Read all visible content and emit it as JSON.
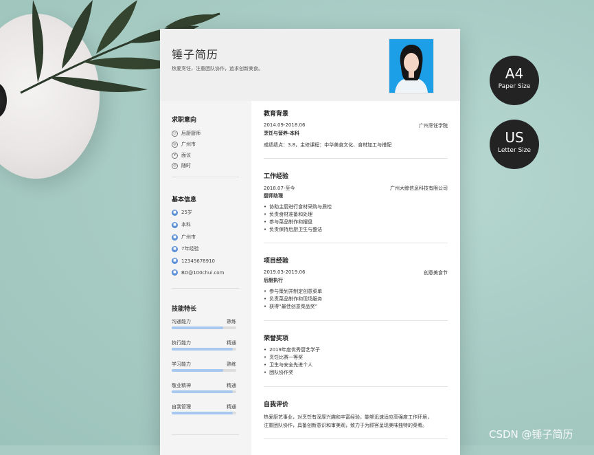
{
  "resume": {
    "name": "锤子简历",
    "motto": "热爱烹饪，注重团队协作，追求创新美食。"
  },
  "sidebar": {
    "intent_title": "求职意向",
    "intent": [
      {
        "icon": "chef-icon",
        "text": "后厨厨师"
      },
      {
        "icon": "location-icon",
        "text": "广州市"
      },
      {
        "icon": "salary-icon",
        "text": "面议"
      },
      {
        "icon": "clock-icon",
        "text": "随时"
      }
    ],
    "basic_title": "基本信息",
    "basic": [
      {
        "icon": "age-icon",
        "text": "25岁"
      },
      {
        "icon": "education-icon",
        "text": "本科"
      },
      {
        "icon": "home-icon",
        "text": "广州市"
      },
      {
        "icon": "experience-icon",
        "text": "7年经验"
      },
      {
        "icon": "phone-icon",
        "text": "12345678910"
      },
      {
        "icon": "email-icon",
        "text": "BD@100chui.com"
      }
    ],
    "skills_title": "技能特长",
    "skills": [
      {
        "name": "沟通能力",
        "level": "熟练",
        "progress": 0.8
      },
      {
        "name": "执行能力",
        "level": "精通",
        "progress": 0.95
      },
      {
        "name": "学习能力",
        "level": "熟练",
        "progress": 0.8
      },
      {
        "name": "敬业精神",
        "level": "精通",
        "progress": 0.95
      },
      {
        "name": "自我管理",
        "level": "精通",
        "progress": 0.95
      }
    ]
  },
  "education": {
    "title": "教育背景",
    "period": "2014.09-2018.06",
    "school": "广州烹饪学院",
    "major": "烹饪与营养-本科",
    "detail": "成绩绩点：3.8，主修课程：中华美食文化、食材加工与搭配"
  },
  "work": {
    "title": "工作经验",
    "period": "2018.07-至今",
    "company": "广州大鲸信息科技有限公司",
    "role": "厨师助理",
    "items": [
      "协助主厨进行食材采购与质检",
      "负责食材准备和处理",
      "参与菜品制作和摆盘",
      "负责保持后厨卫生与整洁"
    ]
  },
  "project": {
    "title": "项目经验",
    "period": "2019.03-2019.06",
    "name": "创意美食节",
    "role": "后厨执行",
    "items": [
      "参与策划并制定创意菜单",
      "负责菜品制作和现场服务",
      "获得“最佳创意菜品奖”"
    ]
  },
  "honors": {
    "title": "荣誉奖项",
    "items": [
      "2019年度优秀厨艺学子",
      "烹饪比赛一等奖",
      "卫生与安全先进个人",
      "团队协作奖"
    ]
  },
  "self_eval": {
    "title": "自我评价",
    "line1": "热爱厨艺事业，对烹饪有深厚兴趣和丰富经验，能够迅速适应高强度工作环境，",
    "line2": "注重团队协作，具备创新意识和审美观，致力于为顾客呈现美味独特的菜肴。"
  },
  "badges": {
    "a4_big": "A4",
    "a4_small": "Paper Size",
    "us_big": "US",
    "us_small": "Letter Size"
  },
  "watermark": "CSDN @锤子简历"
}
